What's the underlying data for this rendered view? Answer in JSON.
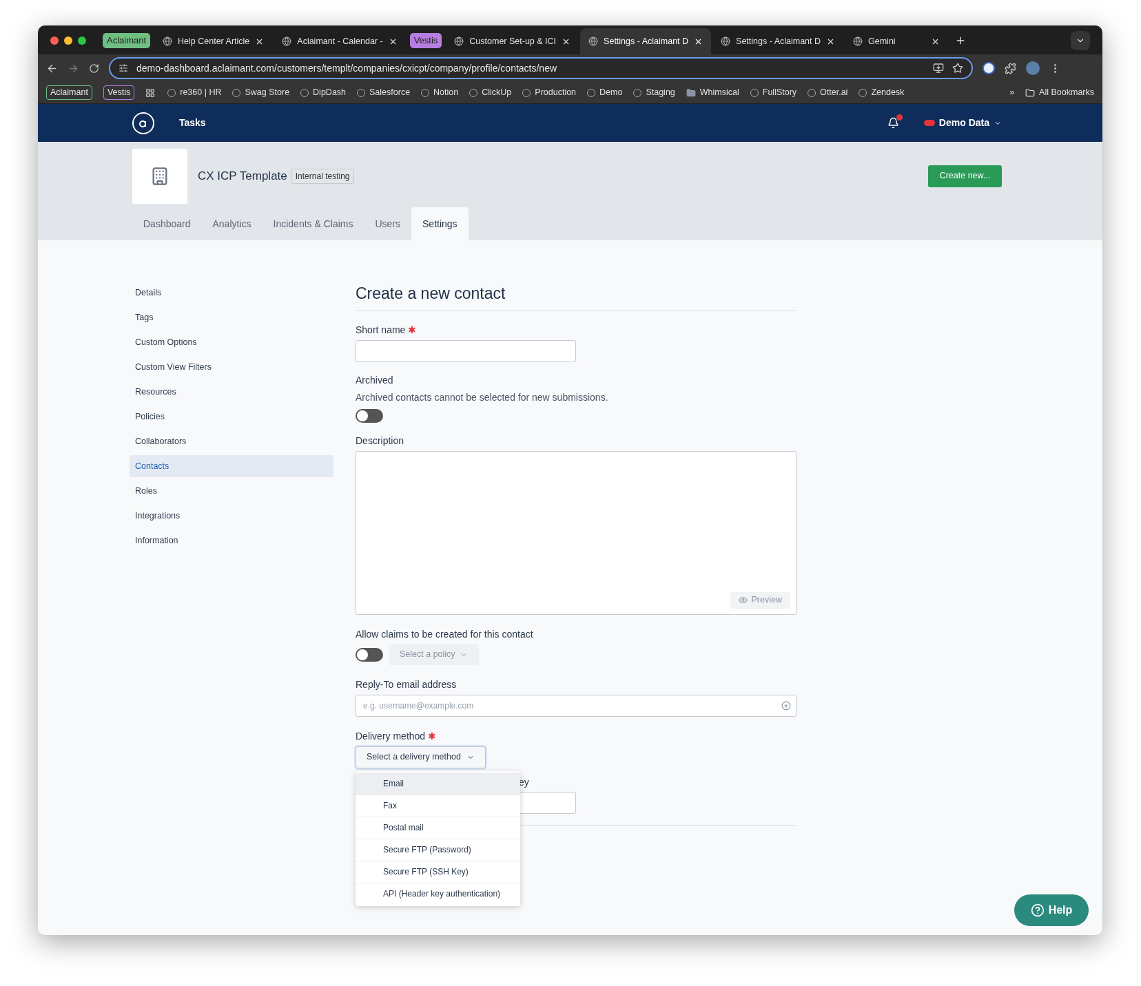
{
  "browser": {
    "tabs": [
      {
        "kind": "group",
        "label": "Aclaimant",
        "color": "#6fbf82"
      },
      {
        "kind": "tab",
        "label": "Help Center Article",
        "selected": false
      },
      {
        "kind": "tab",
        "label": "Aclaimant - Calendar -",
        "selected": false
      },
      {
        "kind": "group",
        "label": "Vestis",
        "color": "#b57ee0"
      },
      {
        "kind": "tab",
        "label": "Customer Set-up & ICI",
        "selected": false
      },
      {
        "kind": "tab",
        "label": "Settings - Aclaimant D",
        "selected": true
      },
      {
        "kind": "tab",
        "label": "Settings - Aclaimant D",
        "selected": false
      },
      {
        "kind": "tab",
        "label": "Gemini",
        "selected": false
      }
    ],
    "url": "demo-dashboard.aclaimant.com/customers/templt/companies/cxicpt/company/profile/contacts/new",
    "bookmarks": [
      {
        "kind": "group",
        "label": "Aclaimant",
        "color": "#6fbf82"
      },
      {
        "kind": "group",
        "label": "Vestis",
        "color": "#b57ee0"
      },
      {
        "kind": "link",
        "label": "re360 | HR"
      },
      {
        "kind": "link",
        "label": "Swag Store"
      },
      {
        "kind": "link",
        "label": "DipDash"
      },
      {
        "kind": "link",
        "label": "Salesforce"
      },
      {
        "kind": "link",
        "label": "Notion"
      },
      {
        "kind": "link",
        "label": "ClickUp"
      },
      {
        "kind": "link",
        "label": "Production"
      },
      {
        "kind": "link",
        "label": "Demo"
      },
      {
        "kind": "link",
        "label": "Staging"
      },
      {
        "kind": "folder",
        "label": "Whimsical"
      },
      {
        "kind": "link",
        "label": "FullStory"
      },
      {
        "kind": "link",
        "label": "Otter.ai"
      },
      {
        "kind": "link",
        "label": "Zendesk"
      }
    ],
    "more": "»",
    "all_bookmarks": "All Bookmarks"
  },
  "app": {
    "nav": "Tasks",
    "account": "Demo Data"
  },
  "company": {
    "name": "CX ICP Template",
    "badge": "Internal testing",
    "create_button": "Create new...",
    "tabs": [
      {
        "label": "Dashboard",
        "selected": false
      },
      {
        "label": "Analytics",
        "selected": false
      },
      {
        "label": "Incidents & Claims",
        "selected": false
      },
      {
        "label": "Users",
        "selected": false
      },
      {
        "label": "Settings",
        "selected": true
      }
    ]
  },
  "sidebar": {
    "items": [
      {
        "label": "Details",
        "selected": false
      },
      {
        "label": "Tags",
        "selected": false
      },
      {
        "label": "Custom Options",
        "selected": false
      },
      {
        "label": "Custom View Filters",
        "selected": false
      },
      {
        "label": "Resources",
        "selected": false
      },
      {
        "label": "Policies",
        "selected": false
      },
      {
        "label": "Collaborators",
        "selected": false
      },
      {
        "label": "Contacts",
        "selected": true
      },
      {
        "label": "Roles",
        "selected": false
      },
      {
        "label": "Integrations",
        "selected": false
      },
      {
        "label": "Information",
        "selected": false
      }
    ]
  },
  "form": {
    "title": "Create a new contact",
    "short_name": {
      "label": "Short name",
      "required_mark": "✱"
    },
    "archived": {
      "label": "Archived",
      "help": "Archived contacts cannot be selected for new submissions.",
      "on": false
    },
    "description": {
      "label": "Description",
      "preview": "Preview"
    },
    "allow_claims": {
      "label": "Allow claims to be created for this contact",
      "on": false,
      "policy": "Select a policy"
    },
    "reply_to": {
      "label": "Reply-To email address",
      "placeholder": "e.g. username@example.com"
    },
    "delivery": {
      "label": "Delivery method",
      "required_mark": "✱",
      "button": "Select a delivery method",
      "options": [
        {
          "label": "Email",
          "selected": true
        },
        {
          "label": "Fax",
          "selected": false
        },
        {
          "label": "Postal mail",
          "selected": false
        },
        {
          "label": "Secure FTP (Password)",
          "selected": false
        },
        {
          "label": "Secure FTP (SSH Key)",
          "selected": false
        },
        {
          "label": "API (Header key authentication)",
          "selected": false
        }
      ]
    },
    "covered_field_label": "ey"
  },
  "help_button": "Help"
}
